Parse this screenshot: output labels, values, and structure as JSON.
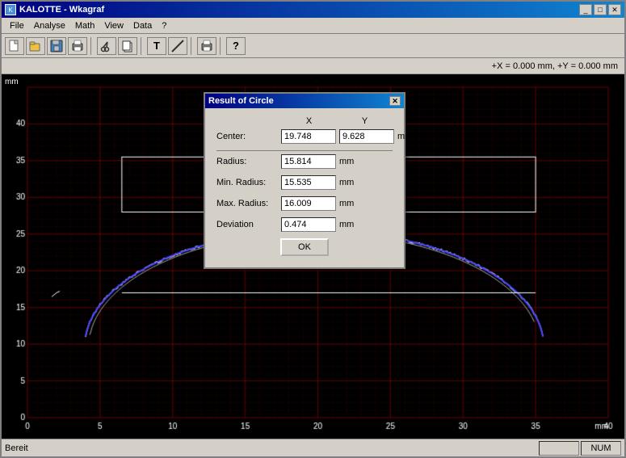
{
  "window": {
    "title": "KALOTTE - Wkagraf",
    "icon": "K"
  },
  "titleButtons": {
    "minimize": "_",
    "maximize": "□",
    "close": "✕"
  },
  "menu": {
    "items": [
      "File",
      "Analyse",
      "Math",
      "View",
      "Data",
      "?"
    ]
  },
  "toolbar": {
    "buttons": [
      {
        "name": "new-icon",
        "symbol": "📄"
      },
      {
        "name": "open-icon",
        "symbol": "📂"
      },
      {
        "name": "save-icon",
        "symbol": "💾"
      },
      {
        "name": "print-icon",
        "symbol": "🖨"
      },
      {
        "name": "cut-icon",
        "symbol": "✂"
      },
      {
        "name": "copy-icon",
        "symbol": "📋"
      },
      {
        "name": "text-icon",
        "symbol": "T"
      },
      {
        "name": "line-icon",
        "symbol": "╱"
      },
      {
        "name": "printer2-icon",
        "symbol": "🖨"
      },
      {
        "name": "help-icon",
        "symbol": "?"
      }
    ]
  },
  "coords": "+X = 0.000 mm, +Y = 0.000 mm",
  "graph": {
    "yLabel": "mm",
    "xLabel": "mm",
    "xMin": 0,
    "xMax": 40,
    "yMin": 0,
    "yMax": 45
  },
  "dialog": {
    "title": "Result of Circle",
    "colLabels": [
      "X",
      "Y"
    ],
    "center": {
      "label": "Center:",
      "x": "19.748",
      "y": "9.628",
      "unit": "mm"
    },
    "radius": {
      "label": "Radius:",
      "value": "15.814",
      "unit": "mm"
    },
    "minRadius": {
      "label": "Min. Radius:",
      "value": "15.535",
      "unit": "mm"
    },
    "maxRadius": {
      "label": "Max. Radius:",
      "value": "16.009",
      "unit": "mm"
    },
    "deviation": {
      "label": "Deviation",
      "value": "0.474",
      "unit": "mm"
    },
    "okButton": "OK"
  },
  "statusBar": {
    "text": "Bereit",
    "indicators": [
      "",
      "NUM"
    ]
  }
}
